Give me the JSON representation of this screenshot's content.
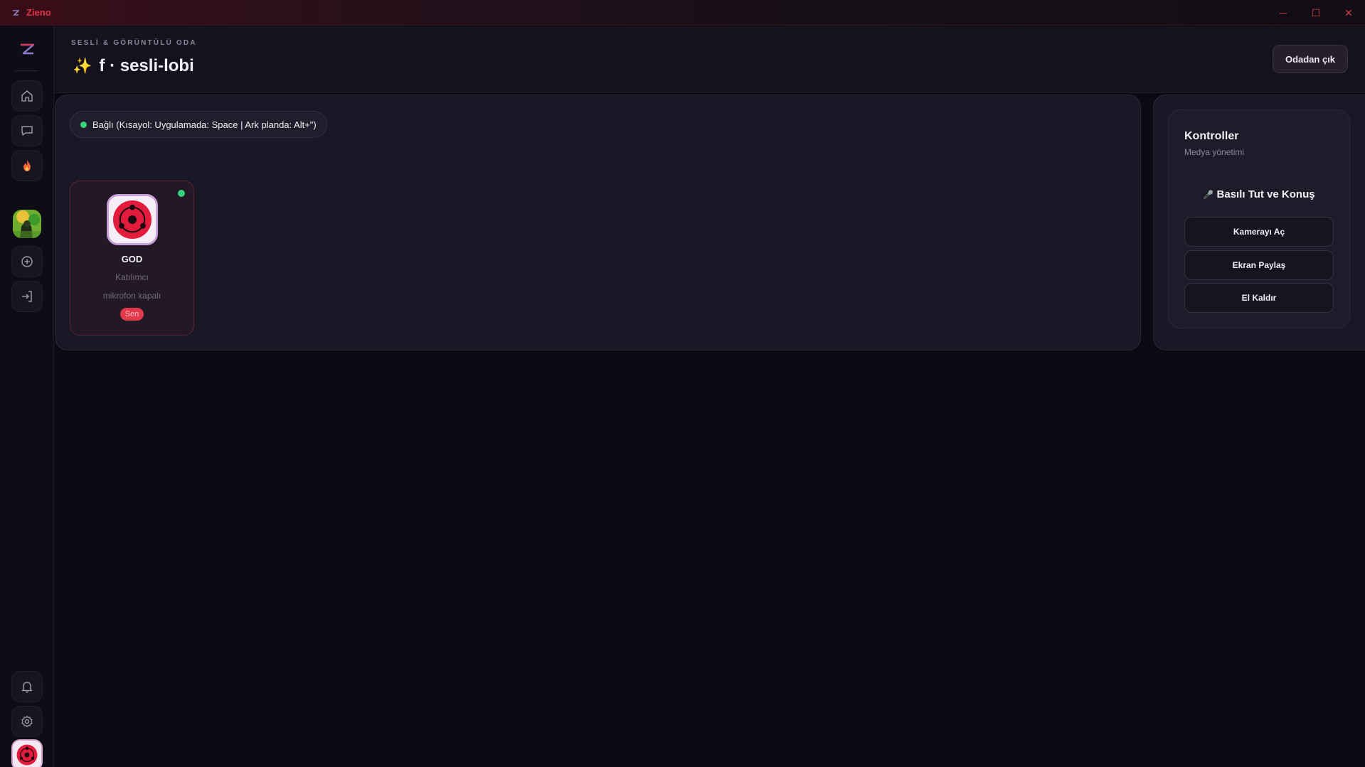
{
  "app": {
    "name": "Zieno"
  },
  "window_controls": {
    "minimize": "─",
    "maximize": "☐",
    "close": "✕"
  },
  "sidebar": {
    "items": [
      {
        "name": "home",
        "icon": "home-icon"
      },
      {
        "name": "messages",
        "icon": "chat-icon"
      },
      {
        "name": "hot",
        "icon": "fire-icon"
      },
      {
        "name": "server",
        "icon": "server-avatar"
      },
      {
        "name": "add-server",
        "icon": "plus-circle-icon"
      },
      {
        "name": "join",
        "icon": "login-icon"
      }
    ],
    "bottom": [
      {
        "name": "notifications",
        "icon": "bell-icon"
      },
      {
        "name": "settings",
        "icon": "gear-icon"
      }
    ]
  },
  "header": {
    "eyebrow": "SESLİ & GÖRÜNTÜLÜ ODA",
    "title": "f · sesli-lobi",
    "title_icon": "✨",
    "leave_label": "Odadan çık"
  },
  "status": {
    "text": "Bağlı (Kısayol: Uygulamada: Space | Ark planda: Alt+\")",
    "color": "#37d27c"
  },
  "participants": [
    {
      "name": "GOD",
      "role": "Katılımcı",
      "mic_status": "mikrofon kapalı",
      "badge": "Sen",
      "online": true
    }
  ],
  "controls": {
    "title": "Kontroller",
    "subtitle": "Medya yönetimi",
    "ptt_icon": "🎤",
    "ptt_label": "Basılı Tut ve Konuş",
    "buttons": [
      "Kamerayı Aç",
      "Ekran Paylaş",
      "El Kaldır"
    ]
  },
  "colors": {
    "accent": "#e0334d",
    "online": "#37d27c",
    "badge": "#e33a4b"
  }
}
